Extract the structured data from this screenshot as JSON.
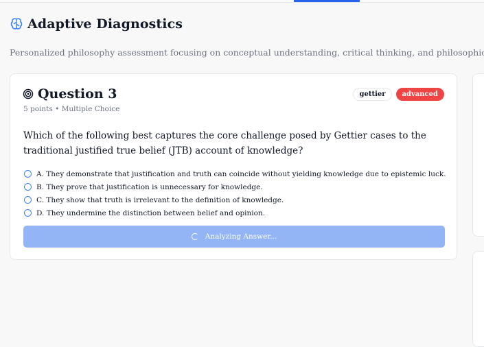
{
  "header": {
    "title": "Adaptive Diagnostics",
    "subtitle": "Personalized philosophy assessment focusing on conceptual understanding, critical thinking, and philosophical reasoning s"
  },
  "question": {
    "title": "Question 3",
    "meta": "5 points • Multiple Choice",
    "tags": [
      "gettier",
      "advanced"
    ],
    "text": "Which of the following best captures the core challenge posed by Gettier cases to the traditional justified true belief (JTB) account of knowledge?",
    "options": [
      "A. They demonstrate that justification and truth can coincide without yielding knowledge due to epistemic luck.",
      "B. They prove that justification is unnecessary for knowledge.",
      "C. They show that truth is irrelevant to the definition of knowledge.",
      "D. They undermine the distinction between belief and opinion."
    ],
    "submit_label": "Analyzing Answer..."
  },
  "colors": {
    "accent": "#2563eb",
    "badge_advanced": "#ef4444",
    "button_disabled": "#93b4f5"
  },
  "icons": {
    "header": "brain-icon",
    "question": "target-icon",
    "radio": "radio-circle",
    "loading": "spinner-icon"
  }
}
